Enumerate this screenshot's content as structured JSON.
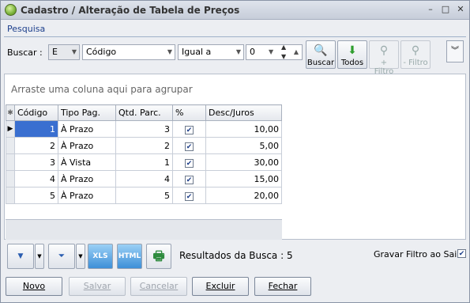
{
  "window": {
    "title": "Cadastro / Alteração de Tabela de Preços"
  },
  "search": {
    "section_label": "Pesquisa",
    "buscar_label": "Buscar :",
    "connector": "E",
    "field": "Código",
    "operator": "Igual a",
    "value": "0",
    "buttons": {
      "buscar": "Buscar",
      "todos": "Todos",
      "add_filtro": "+ Filtro",
      "remove_filtro": "- Filtro"
    }
  },
  "grid": {
    "group_hint": "Arraste uma coluna aqui para agrupar",
    "columns": [
      "Código",
      "Tipo Pag.",
      "Qtd. Parc.",
      "%",
      "Desc/Juros"
    ],
    "rows": [
      {
        "codigo": "1",
        "tipo": "À Prazo",
        "qtd": "3",
        "pct": true,
        "desc": "10,00"
      },
      {
        "codigo": "2",
        "tipo": "À Prazo",
        "qtd": "2",
        "pct": true,
        "desc": "5,00"
      },
      {
        "codigo": "3",
        "tipo": "À Vista",
        "qtd": "1",
        "pct": true,
        "desc": "30,00"
      },
      {
        "codigo": "4",
        "tipo": "À Prazo",
        "qtd": "4",
        "pct": true,
        "desc": "15,00"
      },
      {
        "codigo": "5",
        "tipo": "À Prazo",
        "qtd": "5",
        "pct": true,
        "desc": "20,00"
      }
    ]
  },
  "bottom": {
    "results_label": "Resultados da Busca : 5",
    "gravar_label": "Gravar Filtro ao Sair",
    "gravar_checked": true,
    "icons": [
      "save-filter-icon",
      "filter-icon",
      "xls-export-icon",
      "html-export-icon",
      "print-icon"
    ],
    "xls_text": "XLS",
    "html_text": "HTML"
  },
  "actions": {
    "novo": "Novo",
    "salvar": "Salvar",
    "cancelar": "Cancelar",
    "excluir": "Excluir",
    "fechar": "Fechar"
  }
}
